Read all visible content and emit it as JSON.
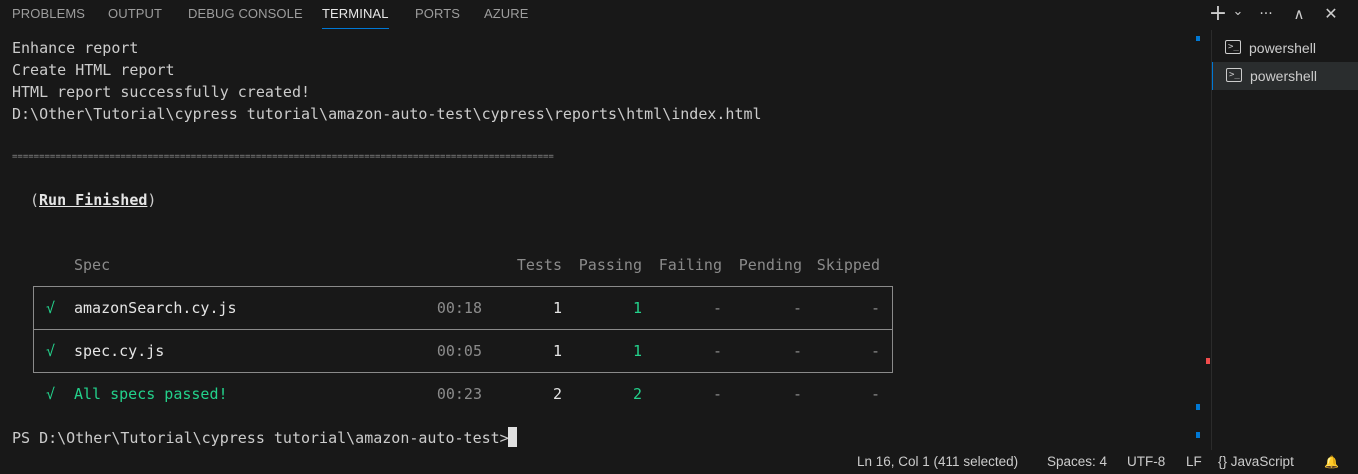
{
  "panel_tabs": [
    "PROBLEMS",
    "OUTPUT",
    "DEBUG CONSOLE",
    "TERMINAL",
    "PORTS",
    "AZURE"
  ],
  "active_tab": "TERMINAL",
  "toolbar": {
    "new_terminal_glyph": "+",
    "dropdown_glyph": "⌄",
    "more_glyph": "···",
    "maximize_glyph": "∧",
    "close_glyph": "✕"
  },
  "terminal": {
    "lines": [
      "Enhance report",
      "Create HTML report",
      "HTML report successfully created!",
      "D:\\Other\\Tutorial\\cypress tutorial\\amazon-auto-test\\cypress\\reports\\html\\index.html"
    ],
    "separator": "====================================================================================================",
    "run_finished_open": "(",
    "run_finished": "Run Finished",
    "run_finished_close": ")",
    "table": {
      "headers": [
        "Spec",
        "Tests",
        "Passing",
        "Failing",
        "Pending",
        "Skipped"
      ],
      "rows": [
        {
          "check": "√",
          "spec": "amazonSearch.cy.js",
          "time": "00:18",
          "tests": "1",
          "passing": "1",
          "failing": "-",
          "pending": "-",
          "skipped": "-"
        },
        {
          "check": "√",
          "spec": "spec.cy.js",
          "time": "00:05",
          "tests": "1",
          "passing": "1",
          "failing": "-",
          "pending": "-",
          "skipped": "-"
        }
      ],
      "summary": {
        "check": "√",
        "text": "All specs passed!",
        "time": "00:23",
        "tests": "2",
        "passing": "2",
        "failing": "-",
        "pending": "-",
        "skipped": "-"
      }
    },
    "prompt": "PS D:\\Other\\Tutorial\\cypress tutorial\\amazon-auto-test>"
  },
  "terminal_list": [
    {
      "icon": ">_",
      "label": "powershell"
    },
    {
      "icon": ">_",
      "label": "powershell"
    }
  ],
  "selected_terminal_index": 1,
  "status_bar": {
    "position": "Ln 16, Col 1 (411 selected)",
    "spaces": "Spaces: 4",
    "encoding": "UTF-8",
    "eol": "LF",
    "language_glyph": "{}",
    "language": "JavaScript",
    "bell_glyph": "🔔"
  },
  "colors": {
    "accent": "#0078d4",
    "pass_green": "#23d18b",
    "error_marker": "#f14c4c"
  }
}
